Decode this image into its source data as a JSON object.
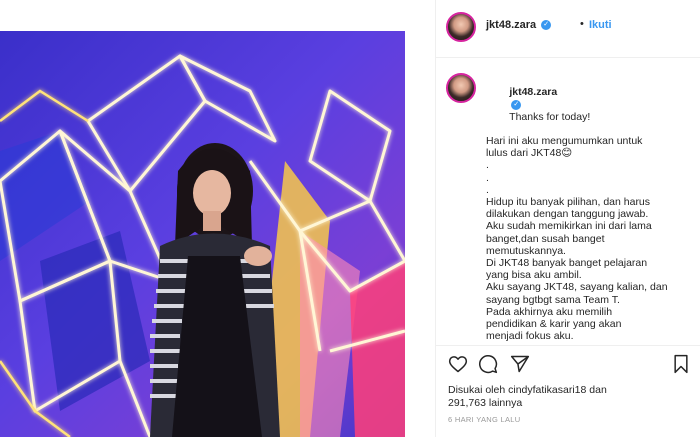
{
  "post": {
    "username": "jkt48.zara",
    "verified_icon": "verified-badge-icon",
    "separator": "•",
    "follow_label": "Ikuti",
    "caption_first": "Thanks for today!",
    "caption_lines": [
      "Hari ini aku mengumumkan untuk",
      "lulus dari JKT48😊",
      ".",
      ".",
      ".",
      "Hidup itu banyak pilihan, dan harus",
      "dilakukan dengan tanggung jawab.",
      "Aku sudah memikirkan ini dari lama",
      "banget,dan susah banget",
      "memutuskannya.",
      "Di JKT48 banyak banget pelajaran",
      "yang bisa aku ambil.",
      "Aku sayang JKT48, sayang kalian, dan",
      "sayang bgtbgt sama Team T.",
      "Pada akhirnya aku memilih",
      "pendidikan & karir yang akan",
      "menjadi fokus aku.",
      "."
    ],
    "likes_prefix": "Disukai oleh",
    "likes_user": "cindyfatikasari18",
    "likes_and": "dan",
    "likes_count": "291,763",
    "likes_suffix": "lainnya",
    "timestamp": "6 HARI YANG LALU"
  },
  "icons": {
    "like": "heart-icon",
    "comment": "comment-icon",
    "share": "share-icon",
    "save": "bookmark-icon"
  },
  "colors": {
    "accent": "#3897f0",
    "text": "#262626",
    "muted": "#999999",
    "border": "#efefef"
  }
}
